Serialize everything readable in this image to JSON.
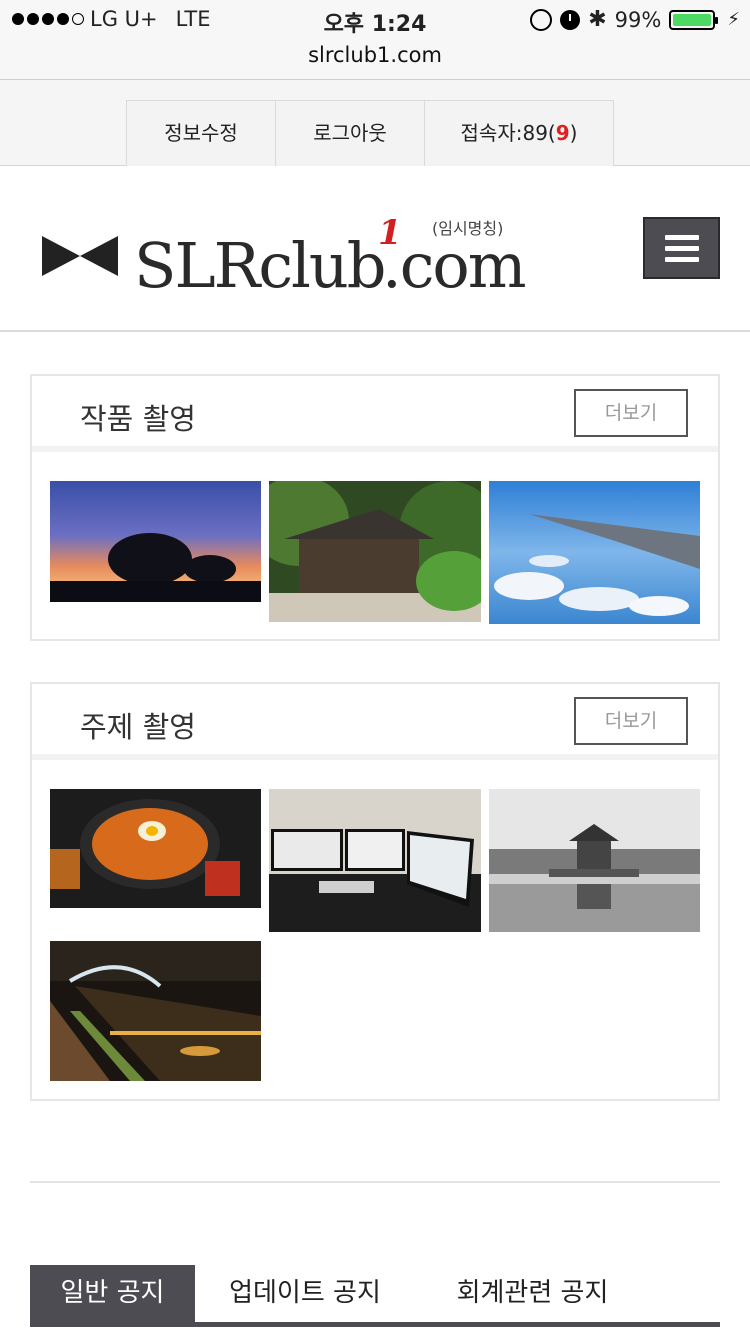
{
  "status_bar": {
    "carrier": "LG U+",
    "network": "LTE",
    "time": "오후 1:24",
    "battery_percent": "99%",
    "battery_level": 0.99,
    "icons": [
      "orientation-lock-icon",
      "alarm-icon",
      "bluetooth-icon",
      "battery-icon",
      "charging-icon"
    ]
  },
  "browser": {
    "url": "slrclub1.com"
  },
  "top_nav": {
    "items": [
      {
        "label": "정보수정"
      },
      {
        "label": "로그아웃"
      },
      {
        "label_prefix": "접속자:89(",
        "label_count": "9",
        "label_suffix": ")"
      }
    ]
  },
  "header": {
    "logo_text": "SLRclub",
    "logo_superscript": "1",
    "logo_domain": ".com",
    "logo_note": "(임시명칭)",
    "menu_icon": "hamburger-menu-icon"
  },
  "sections": [
    {
      "title": "작품 촬영",
      "more_label": "더보기",
      "photos": [
        "sunset-tree-photo",
        "wooden-house-forest-photo",
        "airplane-wing-sky-photo"
      ]
    },
    {
      "title": "주제 촬영",
      "more_label": "더보기",
      "photos": [
        "ramen-bowl-photo",
        "computer-desk-monitors-photo",
        "pavilion-pond-bw-photo",
        "night-stream-bridge-photo"
      ]
    }
  ],
  "bottom_tabs": {
    "items": [
      {
        "label": "일반 공지",
        "active": true
      },
      {
        "label": "업데이트 공지",
        "active": false
      },
      {
        "label": "회계관련 공지",
        "active": false
      }
    ]
  },
  "colors": {
    "accent_dark": "#4c4c52",
    "count_red": "#e02020",
    "battery_green": "#4cd964"
  }
}
